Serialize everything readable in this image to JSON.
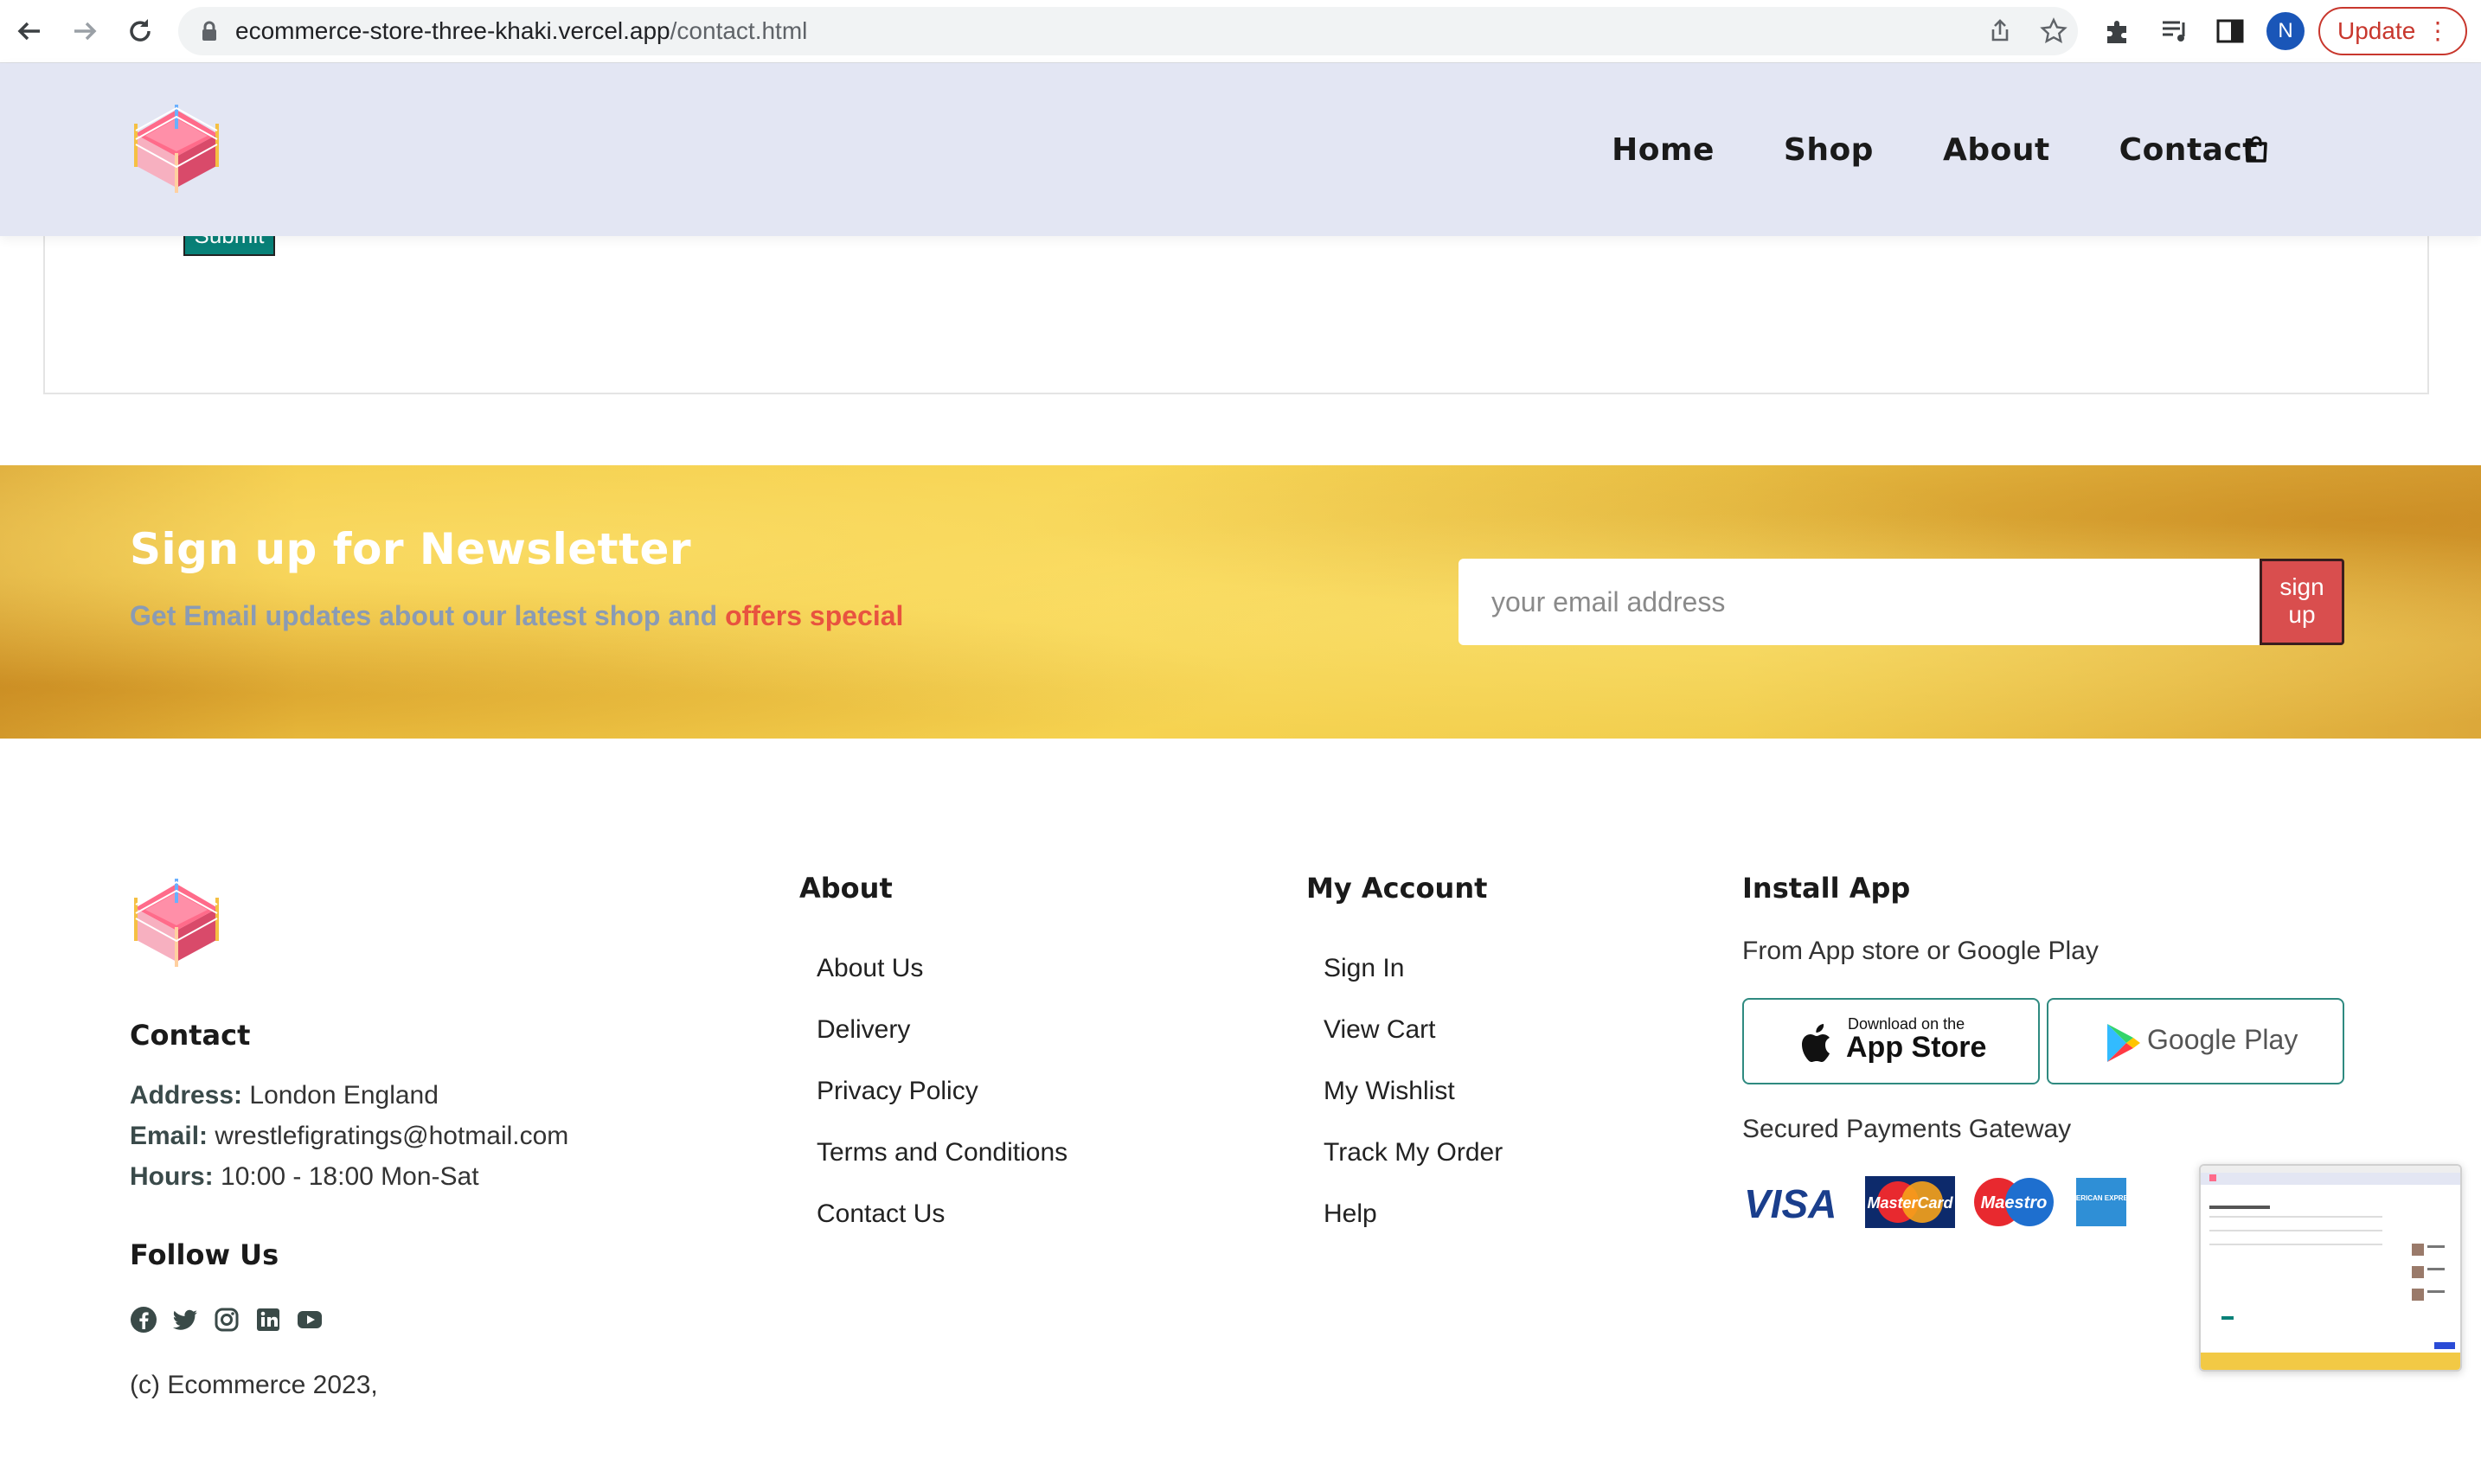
{
  "browser": {
    "url_host": "ecommerce-store-three-khaki.vercel.app",
    "url_path": "/contact.html",
    "profile_initial": "N",
    "update_label": "Update"
  },
  "header": {
    "nav": [
      "Home",
      "Shop",
      "About",
      "Contact"
    ]
  },
  "form": {
    "submit_label": "Submit"
  },
  "newsletter": {
    "title": "Sign up for Newsletter",
    "subtitle_main": "Get Email updates about our latest shop and ",
    "subtitle_accent": "offers special",
    "email_placeholder": "your email address",
    "button_label_line1": "sign",
    "button_label_line2": "up",
    "accent_color": "#e8533f",
    "button_color": "#d94e4e"
  },
  "footer": {
    "contact": {
      "heading": "Contact",
      "address_label": "Address:",
      "address": "London England",
      "email_label": "Email:",
      "email": "wrestlefigratings@hotmail.com",
      "hours_label": "Hours:",
      "hours": "10:00 - 18:00 Mon-Sat",
      "follow_heading": "Follow Us",
      "social_icons": [
        "facebook-icon",
        "twitter-icon",
        "instagram-icon",
        "linkedin-icon",
        "youtube-icon"
      ],
      "copyright": "(c) Ecommerce 2023,"
    },
    "about": {
      "heading": "About",
      "links": [
        "About Us",
        "Delivery",
        "Privacy Policy",
        "Terms and Conditions",
        "Contact Us"
      ]
    },
    "account": {
      "heading": "My Account",
      "links": [
        "Sign In",
        "View Cart",
        "My Wishlist",
        "Track My Order",
        "Help"
      ]
    },
    "install": {
      "heading": "Install App",
      "subtitle": "From App store or Google Play",
      "app_store_small": "Download on the",
      "app_store_big": "App Store",
      "google_play": "Google Play",
      "payments_label": "Secured Payments Gateway",
      "payment_logos": [
        "VISA",
        "MasterCard",
        "Maestro",
        "AMERICAN EXPRESS"
      ]
    }
  }
}
